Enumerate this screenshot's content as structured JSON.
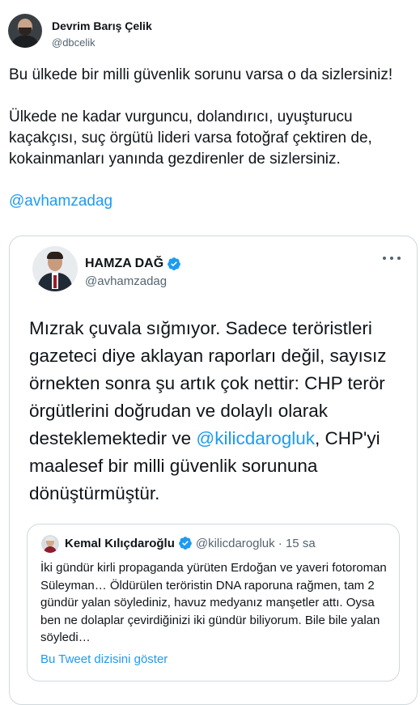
{
  "outer_tweet": {
    "author_name": "Devrim Barış Çelik",
    "author_handle": "@dbcelik",
    "paragraph_1": "Bu ülkede bir milli güvenlik sorunu varsa o da sizlersiniz!",
    "paragraph_2": "Ülkede ne kadar vurguncu, dolandırıcı, uyuşturucu kaçakçısı, suç örgütü lideri varsa fotoğraf çektiren de, kokainmanları yanında gezdirenler de sizlersiniz.",
    "mention": "@avhamzadag"
  },
  "quoted_tweet": {
    "author_name": "HAMZA DAĞ",
    "author_handle": "@avhamzadag",
    "text_before_mention": "Mızrak çuvala sığmıyor. Sadece teröristleri gazeteci diye aklayan raporları değil, sayısız örnekten sonra şu artık çok nettir: CHP terör örgütlerini doğrudan ve dolaylı olarak desteklemektedir ve ",
    "mention": "@kilicdarogluk",
    "text_after_mention": ", CHP'yi maalesef bir milli güvenlik sorununa dönüştürmüştür."
  },
  "nested_tweet": {
    "author_name": "Kemal Kılıçdaroğlu",
    "meta": "@kilicdarogluk · 15 sa",
    "text": "İki gündür kirli propaganda yürüten Erdoğan ve yaveri fotoroman Süleyman… Öldürülen teröristin DNA raporuna rağmen, tam 2 gündür yalan söylediniz, havuz medyanız manşetler attı. Oysa ben ne dolaplar çevirdiğinizi iki gündür biliyorum. Bile bile yalan söyledi…",
    "show_thread": "Bu Tweet dizisini göster"
  },
  "colors": {
    "link": "#1d9bf0",
    "secondary_text": "#536471",
    "border": "#cfd9de"
  }
}
